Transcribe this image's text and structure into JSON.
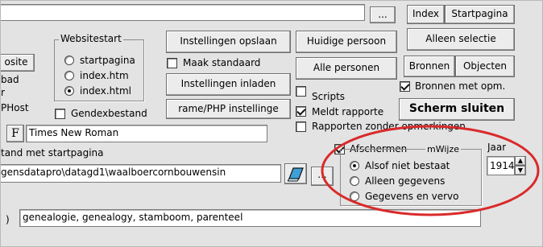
{
  "top_input": {
    "value": "",
    "browse_label": "..."
  },
  "left_cut": {
    "site_button_label": "osite",
    "label_bad": "bad",
    "label_r": "r",
    "label_host": "PHost",
    "label_h": ")"
  },
  "websitestart": {
    "title": "Websitestart",
    "options": [
      {
        "label": "startpagina",
        "selected": false
      },
      {
        "label": "index.htm",
        "selected": false
      },
      {
        "label": "index.html",
        "selected": true
      }
    ]
  },
  "gendex": {
    "label": "Gendexbestand",
    "checked": false
  },
  "settings": {
    "save_label": "Instellingen opslaan",
    "default_label": "Maak standaard",
    "default_checked": false,
    "load_label": "Instellingen inladen",
    "frame_php_label": "rame/PHP instellinge"
  },
  "person_buttons": {
    "current_label": "Huidige persoon",
    "all_label": "Alle personen"
  },
  "right_buttons": {
    "index_label": "Index",
    "startpagina_label": "Startpagina",
    "alleen_selectie_label": "Alleen selectie",
    "bronnen_label": "Bronnen",
    "objecten_label": "Objecten",
    "bronnen_opm_label": "Bronnen met opm.",
    "bronnen_opm_checked": true,
    "close_label": "Scherm sluiten"
  },
  "checks": {
    "scripts_label": "Scripts",
    "scripts_checked": false,
    "meldt_label": "Meldt rapporte",
    "meldt_checked": true,
    "rapporten_label": "Rapporten zonder opmerkingen",
    "rapporten_checked": false
  },
  "font": {
    "button_label": "F",
    "name": "Times New Roman"
  },
  "startpage_label": "tand met startpagina",
  "path": {
    "value": "gensdatapro\\datagd1\\waalboercornbouwensin",
    "browse_label": "..."
  },
  "afschermen": {
    "label": "Afschermen",
    "checked": true,
    "wijze_title": "mWijze",
    "options": [
      {
        "label": "Alsof niet bestaat",
        "selected": true
      },
      {
        "label": "Alleen gegevens",
        "selected": false
      },
      {
        "label": "Gegevens en vervo",
        "selected": false
      }
    ]
  },
  "jaar": {
    "label": "Jaar",
    "value": "1914"
  },
  "keywords": {
    "value": "genealogie, genealogy, stamboom, parenteel"
  },
  "colors": {
    "highlight_circle": "#d92a2a",
    "eraser_icon": "#3fa0d8"
  }
}
